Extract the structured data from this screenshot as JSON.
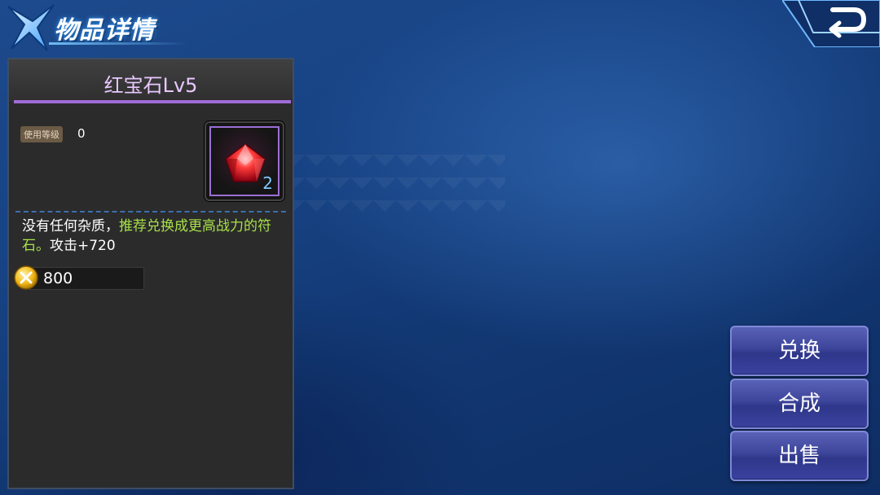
{
  "header": {
    "title": "物品详情",
    "logo_icon": "x-emblem-icon",
    "back_icon": "back-arrow-icon"
  },
  "item": {
    "name": "红宝石Lv5",
    "level_label": "使用等级",
    "level_value": "0",
    "count": "2",
    "icon": "red-gem-icon",
    "description_plain_1": "没有任何杂质，",
    "description_green": "推荐兑换成更高战力的符石。",
    "description_plain_2": "攻击+720",
    "price": "800",
    "price_icon": "gold-coin-icon"
  },
  "actions": {
    "exchange_label": "兑换",
    "compose_label": "合成",
    "sell_label": "出售"
  },
  "colors": {
    "item_name": "#e8c8ff",
    "highlight_text": "#a7e04a",
    "accent_purple": "#a06cd8",
    "button_blue": "#3d459a"
  }
}
